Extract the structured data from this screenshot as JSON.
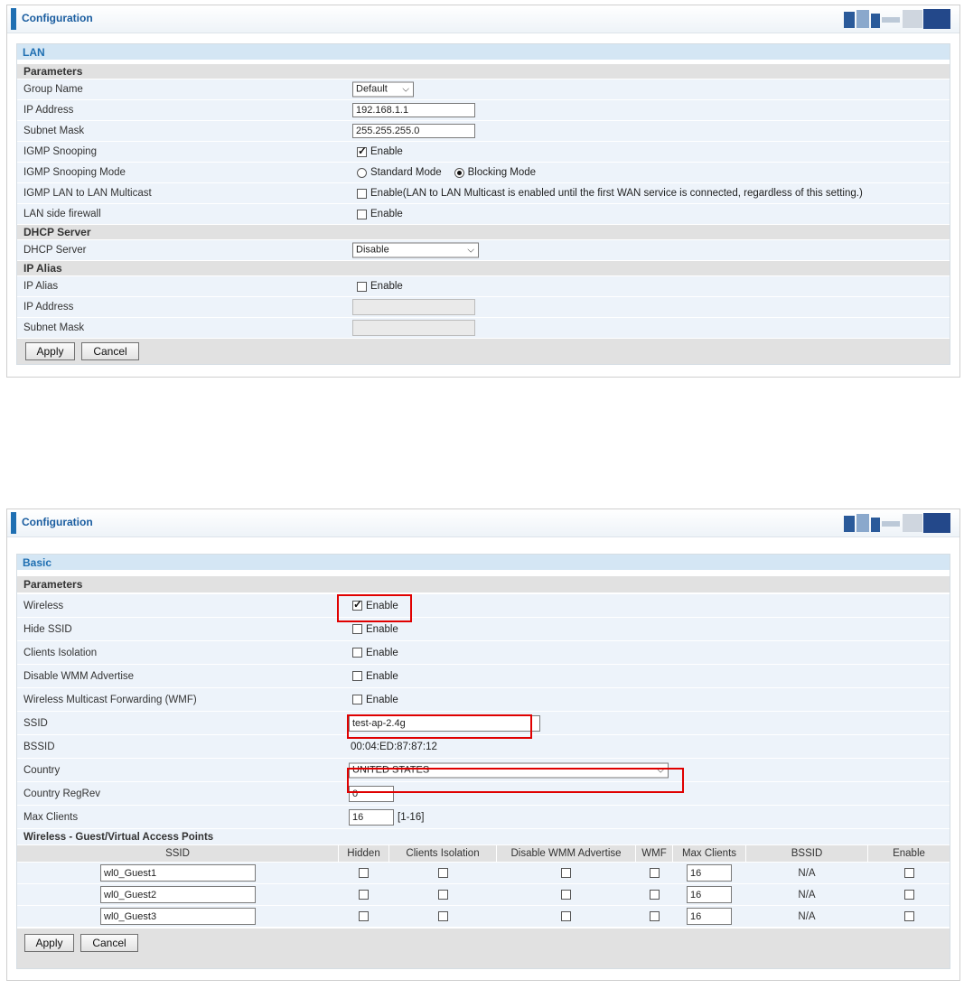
{
  "panel1": {
    "header_title": "Configuration",
    "section_toggle": "LAN",
    "parameters_heading": "Parameters",
    "group_name": {
      "label": "Group Name",
      "value": "Default"
    },
    "ip_address": {
      "label": "IP Address",
      "value": "192.168.1.1"
    },
    "subnet_mask": {
      "label": "Subnet Mask",
      "value": "255.255.255.0"
    },
    "igmp_snooping": {
      "label": "IGMP Snooping",
      "option": "Enable",
      "checked": true
    },
    "igmp_mode": {
      "label": "IGMP Snooping Mode",
      "standard": "Standard Mode",
      "blocking": "Blocking Mode",
      "selected": "Blocking Mode"
    },
    "igmp_lan": {
      "label": "IGMP LAN to LAN Multicast",
      "option": "Enable(LAN to LAN Multicast is enabled until the first WAN service is connected, regardless of this setting.)",
      "checked": false
    },
    "lan_firewall": {
      "label": "LAN side firewall",
      "option": "Enable",
      "checked": false
    },
    "dhcp_heading": "DHCP Server",
    "dhcp_server": {
      "label": "DHCP Server",
      "value": "Disable"
    },
    "ipalias_heading": "IP Alias",
    "ip_alias": {
      "label": "IP Alias",
      "option": "Enable",
      "checked": false
    },
    "alias_ip": {
      "label": "IP Address",
      "value": ""
    },
    "alias_mask": {
      "label": "Subnet Mask",
      "value": ""
    },
    "apply_label": "Apply",
    "cancel_label": "Cancel"
  },
  "panel2": {
    "header_title": "Configuration",
    "section_toggle": "Basic",
    "parameters_heading": "Parameters",
    "wireless": {
      "label": "Wireless",
      "option": "Enable",
      "checked": true
    },
    "hide_ssid": {
      "label": "Hide SSID",
      "option": "Enable",
      "checked": false
    },
    "clients_isolation": {
      "label": "Clients Isolation",
      "option": "Enable",
      "checked": false
    },
    "disable_wmm": {
      "label": "Disable WMM Advertise",
      "option": "Enable",
      "checked": false
    },
    "wmf": {
      "label": "Wireless Multicast Forwarding (WMF)",
      "option": "Enable",
      "checked": false
    },
    "ssid": {
      "label": "SSID",
      "value": "test-ap-2.4g"
    },
    "bssid": {
      "label": "BSSID",
      "value": "00:04:ED:87:87:12"
    },
    "country": {
      "label": "Country",
      "value": "UNITED STATES"
    },
    "regrev": {
      "label": "Country RegRev",
      "value": "0"
    },
    "max_clients": {
      "label": "Max Clients",
      "value": "16",
      "range": "[1-16]"
    },
    "guest_heading": "Wireless - Guest/Virtual Access Points",
    "guest_columns": [
      "SSID",
      "Hidden",
      "Clients Isolation",
      "Disable WMM Advertise",
      "WMF",
      "Max Clients",
      "BSSID",
      "Enable"
    ],
    "guest_rows": [
      {
        "ssid": "wl0_Guest1",
        "max": "16",
        "bssid": "N/A"
      },
      {
        "ssid": "wl0_Guest2",
        "max": "16",
        "bssid": "N/A"
      },
      {
        "ssid": "wl0_Guest3",
        "max": "16",
        "bssid": "N/A"
      }
    ],
    "apply_label": "Apply",
    "cancel_label": "Cancel"
  },
  "colors": {
    "accent": "#1f6fb2",
    "highlight": "#e00000",
    "section_bg": "#e1e1e1",
    "row_bg": "#edf3fa"
  }
}
